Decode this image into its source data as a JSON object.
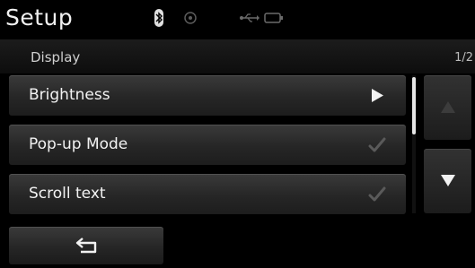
{
  "header": {
    "title": "Setup",
    "status_icons": [
      "bluetooth-icon",
      "disc-icon",
      "usb-icon",
      "battery-icon"
    ]
  },
  "section": {
    "title": "Display",
    "page_indicator": "1/2"
  },
  "menu": {
    "items": [
      {
        "label": "Brightness",
        "control": "arrow-right-icon"
      },
      {
        "label": "Pop-up Mode",
        "control": "checkmark-icon",
        "checked": true
      },
      {
        "label": "Scroll text",
        "control": "checkmark-icon",
        "checked": true
      }
    ]
  },
  "scroll": {
    "up_icon": "triangle-up-icon",
    "down_icon": "triangle-down-icon",
    "up_enabled": false,
    "down_enabled": true
  },
  "footer": {
    "back_icon": "back-arrow-icon"
  },
  "colors": {
    "background": "#000000",
    "text": "#f2f2f2",
    "row_top": "#3a3a3a",
    "row_bottom": "#1d1d1d",
    "check_muted": "#5a5a5a"
  }
}
